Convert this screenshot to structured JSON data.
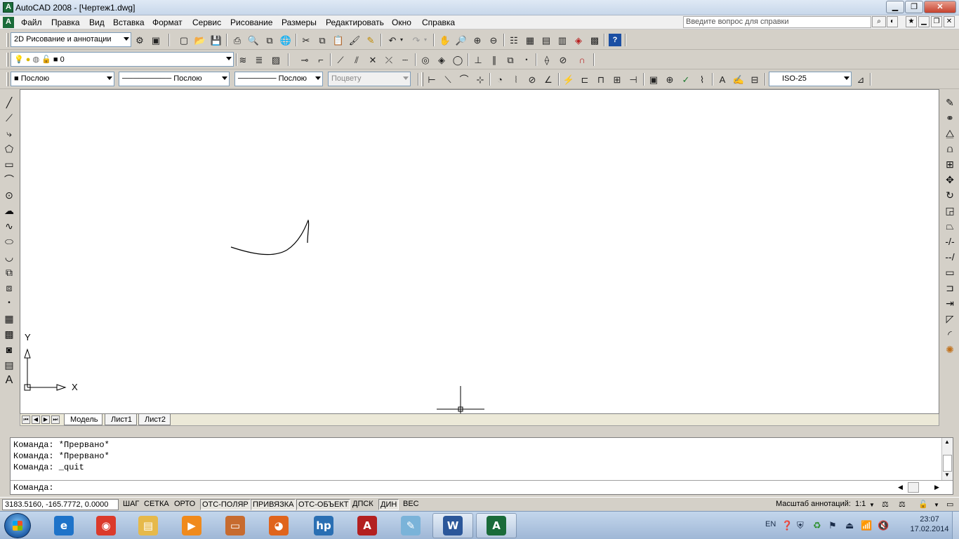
{
  "window": {
    "title": "AutoCAD 2008 - [Чертеж1.dwg]"
  },
  "menu": {
    "items": [
      "Файл",
      "Правка",
      "Вид",
      "Вставка",
      "Формат",
      "Сервис",
      "Рисование",
      "Размеры",
      "Редактировать",
      "Окно",
      "Справка"
    ],
    "help_placeholder": "Введите вопрос для справки"
  },
  "toolbar1": {
    "workspace": "2D Рисование и аннотации"
  },
  "toolbar2": {
    "layer": "0"
  },
  "toolbar3": {
    "color": "Послою",
    "linetype": "Послою",
    "lineweight": "Послою",
    "plotstyle": "Поцвету",
    "dimstyle": "ISO-25"
  },
  "canvas": {
    "ucs_x": "X",
    "ucs_y": "Y"
  },
  "layout_tabs": {
    "model": "Модель",
    "sheet1": "Лист1",
    "sheet2": "Лист2"
  },
  "command": {
    "history": [
      "Команда: *Прервано*",
      "Команда: *Прервано*",
      "Команда: _quit"
    ],
    "prompt": "Команда:"
  },
  "status": {
    "coords": "3183.5160, -165.7772, 0.0000",
    "toggles": [
      {
        "label": "ШАГ",
        "on": false
      },
      {
        "label": "СЕТКА",
        "on": false
      },
      {
        "label": "ОРТО",
        "on": false
      },
      {
        "label": "ОТС-ПОЛЯР",
        "on": true
      },
      {
        "label": "ПРИВЯЗКА",
        "on": true
      },
      {
        "label": "ОТС-ОБЪЕКТ",
        "on": true
      },
      {
        "label": "ДПСК",
        "on": false
      },
      {
        "label": "ДИН",
        "on": true
      },
      {
        "label": "ВЕС",
        "on": false
      }
    ],
    "annotation_scale_label": "Масштаб аннотаций:",
    "annotation_scale": "1:1"
  },
  "taskbar": {
    "apps": [
      {
        "name": "Internet Explorer",
        "icon": "ie-icon",
        "color": "#1e73c9",
        "glyph": "e",
        "open": false
      },
      {
        "name": "Google Chrome",
        "icon": "chrome-icon",
        "color": "#db3a2b",
        "glyph": "◉",
        "open": false
      },
      {
        "name": "Windows Explorer",
        "icon": "folder-icon",
        "color": "#e6b94a",
        "glyph": "▤",
        "open": false
      },
      {
        "name": "Media Player",
        "icon": "media-icon",
        "color": "#f08a1c",
        "glyph": "▶",
        "open": false
      },
      {
        "name": "Scanner",
        "icon": "scanner-icon",
        "color": "#c76b2f",
        "glyph": "▭",
        "open": false
      },
      {
        "name": "Firefox",
        "icon": "firefox-icon",
        "color": "#e0641c",
        "glyph": "◕",
        "open": false
      },
      {
        "name": "HP",
        "icon": "hp-icon",
        "color": "#2a6fb3",
        "glyph": "hp",
        "open": false
      },
      {
        "name": "AutoCAD",
        "icon": "autocad-icon",
        "color": "#b32020",
        "glyph": "A",
        "open": false
      },
      {
        "name": "Paint",
        "icon": "paint-icon",
        "color": "#7ab3d9",
        "glyph": "✎",
        "open": false
      },
      {
        "name": "Word",
        "icon": "word-icon",
        "color": "#2b579a",
        "glyph": "W",
        "open": true
      },
      {
        "name": "AutoCAD 2008",
        "icon": "autocad2008-icon",
        "color": "#1a6b3a",
        "glyph": "A",
        "open": true
      }
    ],
    "language": "EN",
    "time": "23:07",
    "date": "17.02.2014"
  }
}
